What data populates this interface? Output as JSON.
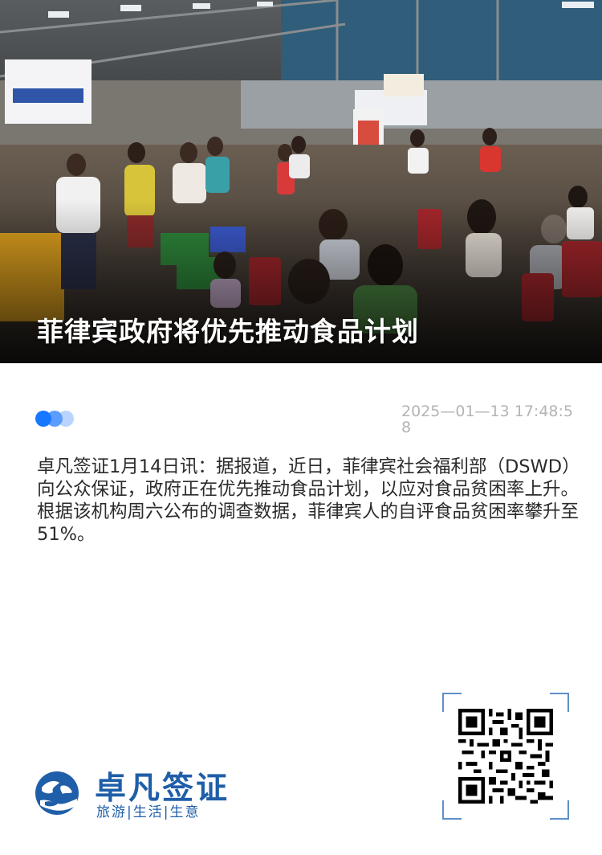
{
  "article": {
    "headline": "菲律宾政府将优先推动食品计划",
    "timestamp": "2025—01—13 17:48:58",
    "body": "卓凡签证1月14日讯：据报道，近日，菲律宾社会福利部（DSWD）向公众保证，政府正在优先推动食品计划，以应对食品贫困率上升。根据该机构周六公布的调查数据，菲律宾人的自评食品贫困率攀升至51%。"
  },
  "hero": {
    "image_subject": "crowd-at-food-distribution-warehouse"
  },
  "brand": {
    "name": "卓凡签证",
    "tagline": "旅游|生活|生意",
    "color": "#1f5ea8",
    "logo_icon": "globe-hand-icon"
  },
  "qr": {
    "icon": "qr-code-icon"
  },
  "colors": {
    "accent": "#1677ff",
    "timestamp": "#b4b4b4",
    "body_text": "#2b2b2b"
  }
}
